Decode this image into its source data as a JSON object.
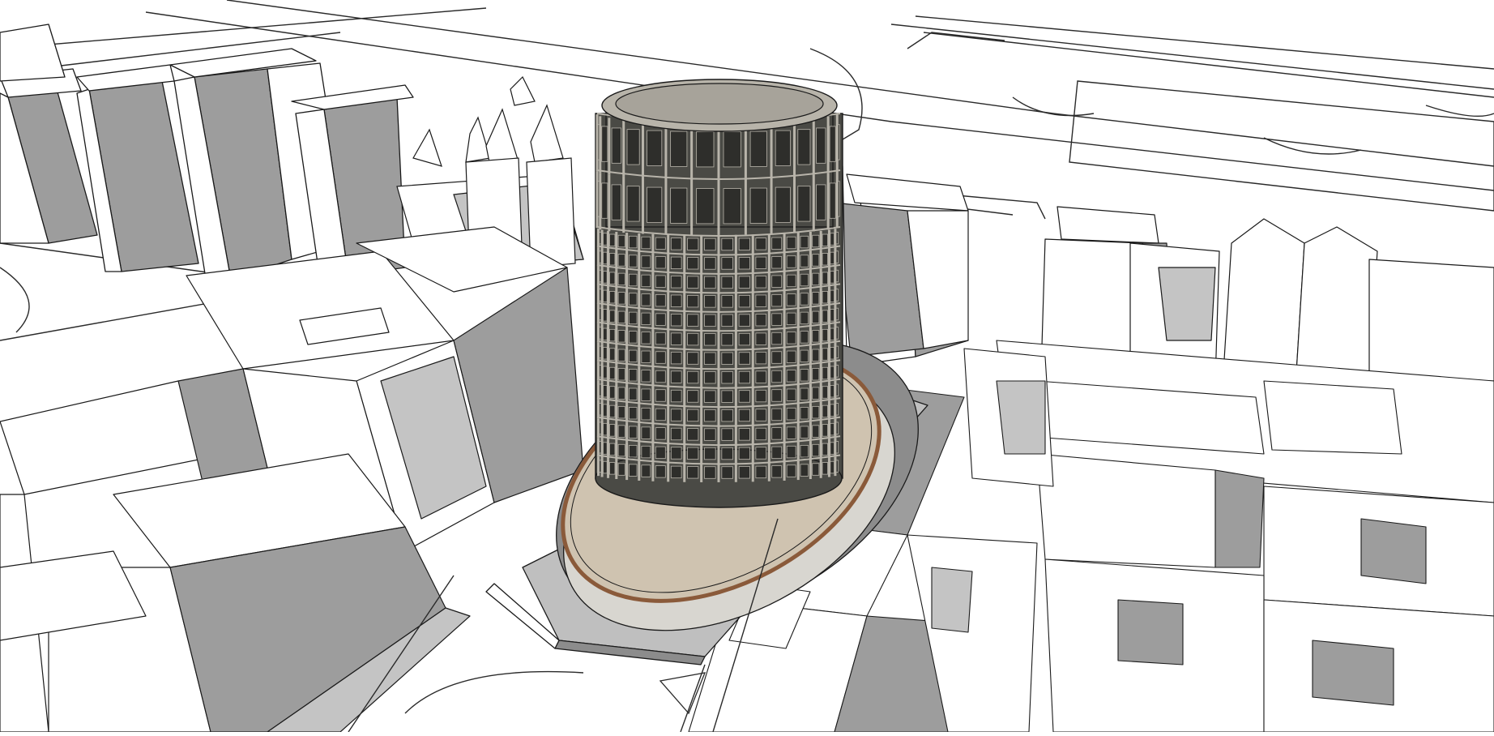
{
  "scene": {
    "subject": "cylindrical-tower-massing-model",
    "style": "sketch-line-model",
    "colors": {
      "background": "#ffffff",
      "line": "#1a1a1a",
      "shadow": "#9d9d9d",
      "shadow_light": "#c4c4c4",
      "tower_facade": "#4a4a45",
      "tower_frame": "#b8b4aa",
      "tower_roof": "#a7a39a",
      "podium_roof": "#cfc3b0",
      "podium_edge": "#8a5a3a",
      "plaza_dark": "#8c8c8c",
      "road_line": "#2a2a2a"
    },
    "tower": {
      "floors": 13,
      "crown_levels": 2,
      "bays": 22
    }
  }
}
